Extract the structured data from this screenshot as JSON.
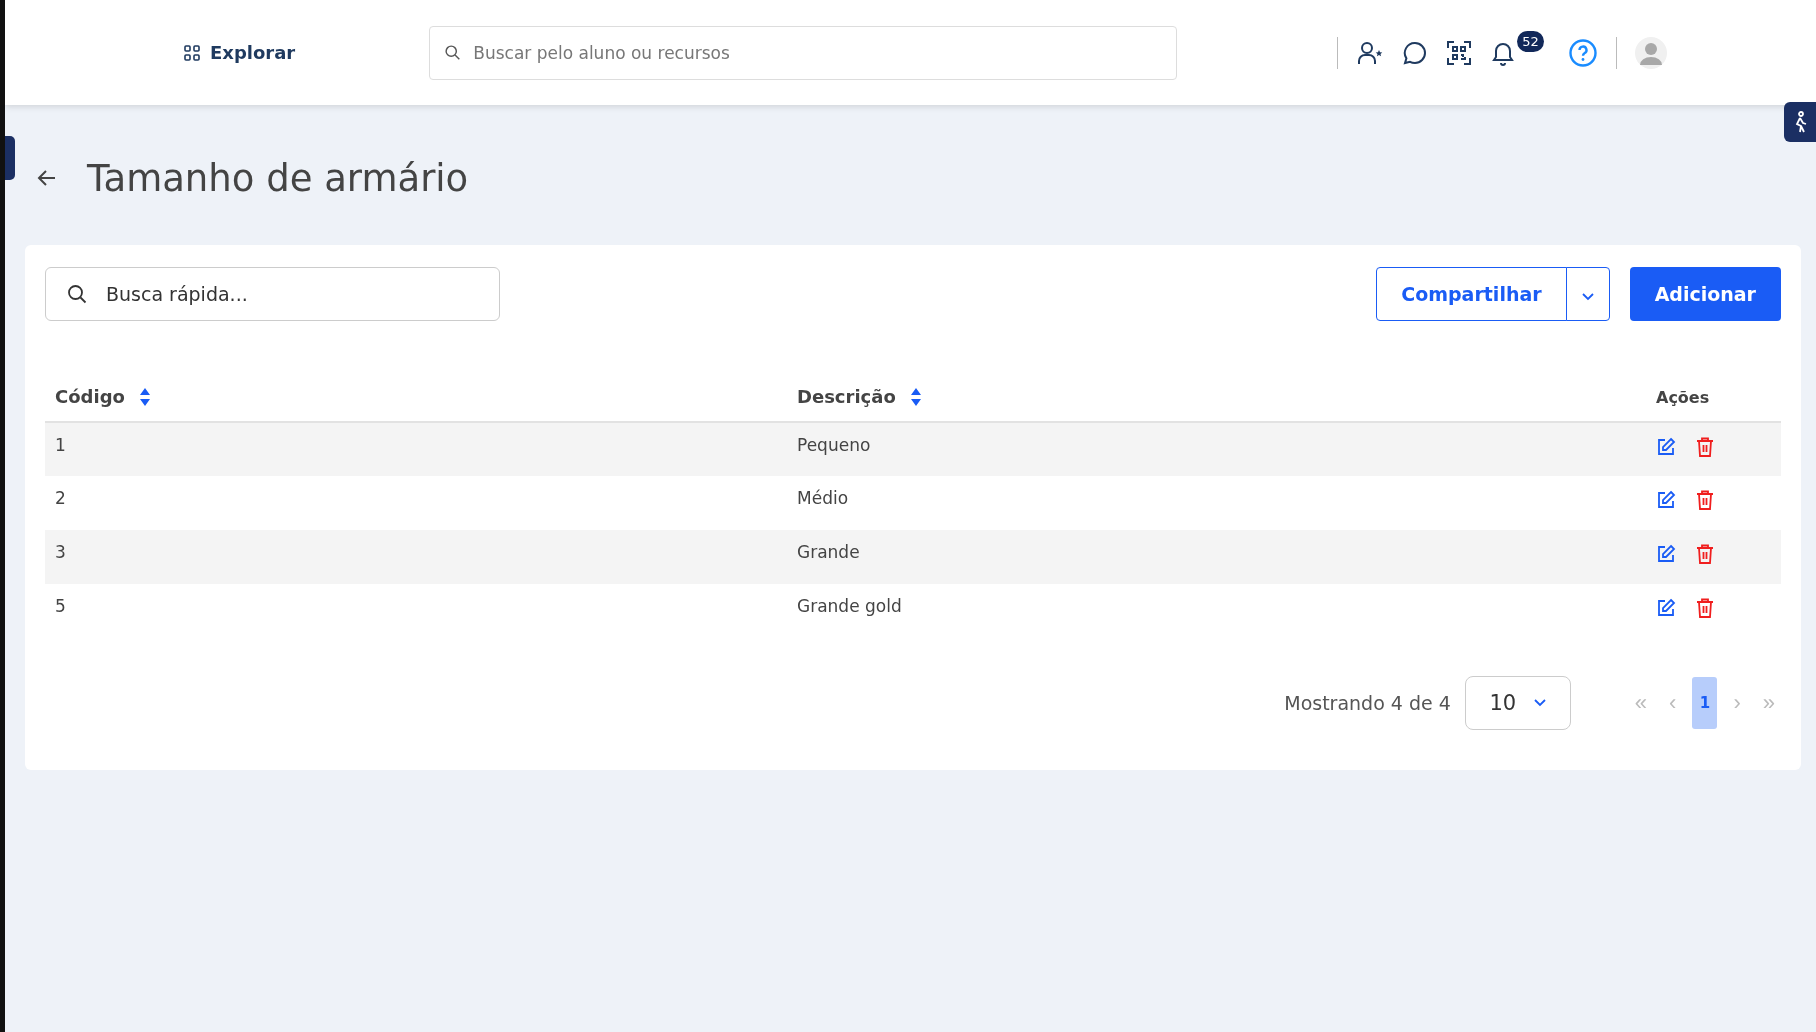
{
  "header": {
    "explore_label": "Explorar",
    "search_placeholder": "Buscar pelo aluno ou recursos",
    "notification_count": "52"
  },
  "page": {
    "title": "Tamanho de armário"
  },
  "toolbar": {
    "search_placeholder": "Busca rápida...",
    "share_label": "Compartilhar",
    "add_label": "Adicionar"
  },
  "table": {
    "columns": [
      {
        "label": "Código",
        "sortable": true
      },
      {
        "label": "Descrição",
        "sortable": true
      },
      {
        "label": "Ações",
        "sortable": false
      }
    ],
    "rows": [
      {
        "code": "1",
        "description": "Pequeno"
      },
      {
        "code": "2",
        "description": "Médio"
      },
      {
        "code": "3",
        "description": "Grande"
      },
      {
        "code": "5",
        "description": "Grande gold"
      }
    ]
  },
  "pagination": {
    "summary": "Mostrando 4 de 4",
    "page_size": "10",
    "first": "«",
    "prev": "‹",
    "next": "›",
    "last": "»",
    "pages": [
      {
        "label": "1",
        "selected": true
      }
    ]
  }
}
